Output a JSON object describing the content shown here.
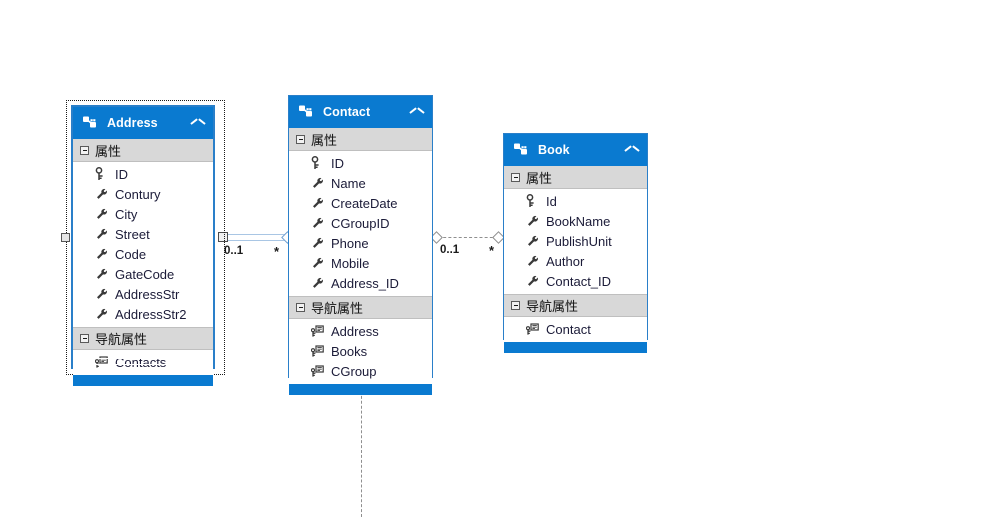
{
  "diagram": {
    "type": "entity-data-model-diagram",
    "background": "#ffffff",
    "accent_color": "#0a7ad0",
    "section_header_color": "#d8d8d8"
  },
  "entities": [
    {
      "id": "address",
      "title": "Address",
      "selected": true,
      "collapse_state": "expanded",
      "sections": [
        {
          "label": "属性",
          "collapsed": false,
          "properties": [
            {
              "name": "ID",
              "icon": "primary-key-icon"
            },
            {
              "name": "Contury",
              "icon": "scalar-property-icon"
            },
            {
              "name": "City",
              "icon": "scalar-property-icon"
            },
            {
              "name": "Street",
              "icon": "scalar-property-icon"
            },
            {
              "name": "Code",
              "icon": "scalar-property-icon"
            },
            {
              "name": "GateCode",
              "icon": "scalar-property-icon"
            },
            {
              "name": "AddressStr",
              "icon": "scalar-property-icon"
            },
            {
              "name": "AddressStr2",
              "icon": "scalar-property-icon"
            }
          ]
        },
        {
          "label": "导航属性",
          "collapsed": false,
          "properties": [
            {
              "name": "Contacts",
              "icon": "navigation-property-icon"
            }
          ]
        }
      ]
    },
    {
      "id": "contact",
      "title": "Contact",
      "selected": false,
      "collapse_state": "expanded",
      "sections": [
        {
          "label": "属性",
          "collapsed": false,
          "properties": [
            {
              "name": "ID",
              "icon": "primary-key-icon"
            },
            {
              "name": "Name",
              "icon": "scalar-property-icon"
            },
            {
              "name": "CreateDate",
              "icon": "scalar-property-icon"
            },
            {
              "name": "CGroupID",
              "icon": "scalar-property-icon"
            },
            {
              "name": "Phone",
              "icon": "scalar-property-icon"
            },
            {
              "name": "Mobile",
              "icon": "scalar-property-icon"
            },
            {
              "name": "Address_ID",
              "icon": "scalar-property-icon"
            }
          ]
        },
        {
          "label": "导航属性",
          "collapsed": false,
          "properties": [
            {
              "name": "Address",
              "icon": "navigation-property-icon"
            },
            {
              "name": "Books",
              "icon": "navigation-property-icon"
            },
            {
              "name": "CGroup",
              "icon": "navigation-property-icon"
            }
          ]
        }
      ]
    },
    {
      "id": "book",
      "title": "Book",
      "selected": false,
      "collapse_state": "expanded",
      "sections": [
        {
          "label": "属性",
          "collapsed": false,
          "properties": [
            {
              "name": "Id",
              "icon": "primary-key-icon"
            },
            {
              "name": "BookName",
              "icon": "scalar-property-icon"
            },
            {
              "name": "PublishUnit",
              "icon": "scalar-property-icon"
            },
            {
              "name": "Author",
              "icon": "scalar-property-icon"
            },
            {
              "name": "Contact_ID",
              "icon": "scalar-property-icon"
            }
          ]
        },
        {
          "label": "导航属性",
          "collapsed": false,
          "properties": [
            {
              "name": "Contact",
              "icon": "navigation-property-icon"
            }
          ]
        }
      ]
    }
  ],
  "associations": [
    {
      "id": "address-contact",
      "selected": true,
      "from": "address",
      "to": "contact",
      "source_multiplicity": "0..1",
      "target_multiplicity": "*"
    },
    {
      "id": "contact-book",
      "selected": false,
      "from": "contact",
      "to": "book",
      "source_multiplicity": "0..1",
      "target_multiplicity": "*"
    },
    {
      "id": "contact-cgroup",
      "selected": false,
      "from": "contact",
      "to": "cgroup",
      "source_multiplicity": "",
      "target_multiplicity": "*"
    }
  ]
}
